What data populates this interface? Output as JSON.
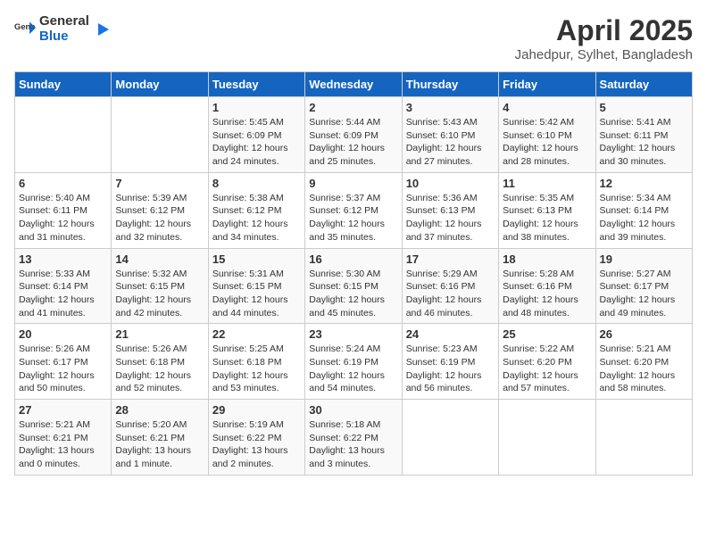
{
  "logo": {
    "general": "General",
    "blue": "Blue"
  },
  "title": "April 2025",
  "subtitle": "Jahedpur, Sylhet, Bangladesh",
  "days_of_week": [
    "Sunday",
    "Monday",
    "Tuesday",
    "Wednesday",
    "Thursday",
    "Friday",
    "Saturday"
  ],
  "weeks": [
    [
      {
        "day": "",
        "info": ""
      },
      {
        "day": "",
        "info": ""
      },
      {
        "day": "1",
        "info": "Sunrise: 5:45 AM\nSunset: 6:09 PM\nDaylight: 12 hours and 24 minutes."
      },
      {
        "day": "2",
        "info": "Sunrise: 5:44 AM\nSunset: 6:09 PM\nDaylight: 12 hours and 25 minutes."
      },
      {
        "day": "3",
        "info": "Sunrise: 5:43 AM\nSunset: 6:10 PM\nDaylight: 12 hours and 27 minutes."
      },
      {
        "day": "4",
        "info": "Sunrise: 5:42 AM\nSunset: 6:10 PM\nDaylight: 12 hours and 28 minutes."
      },
      {
        "day": "5",
        "info": "Sunrise: 5:41 AM\nSunset: 6:11 PM\nDaylight: 12 hours and 30 minutes."
      }
    ],
    [
      {
        "day": "6",
        "info": "Sunrise: 5:40 AM\nSunset: 6:11 PM\nDaylight: 12 hours and 31 minutes."
      },
      {
        "day": "7",
        "info": "Sunrise: 5:39 AM\nSunset: 6:12 PM\nDaylight: 12 hours and 32 minutes."
      },
      {
        "day": "8",
        "info": "Sunrise: 5:38 AM\nSunset: 6:12 PM\nDaylight: 12 hours and 34 minutes."
      },
      {
        "day": "9",
        "info": "Sunrise: 5:37 AM\nSunset: 6:12 PM\nDaylight: 12 hours and 35 minutes."
      },
      {
        "day": "10",
        "info": "Sunrise: 5:36 AM\nSunset: 6:13 PM\nDaylight: 12 hours and 37 minutes."
      },
      {
        "day": "11",
        "info": "Sunrise: 5:35 AM\nSunset: 6:13 PM\nDaylight: 12 hours and 38 minutes."
      },
      {
        "day": "12",
        "info": "Sunrise: 5:34 AM\nSunset: 6:14 PM\nDaylight: 12 hours and 39 minutes."
      }
    ],
    [
      {
        "day": "13",
        "info": "Sunrise: 5:33 AM\nSunset: 6:14 PM\nDaylight: 12 hours and 41 minutes."
      },
      {
        "day": "14",
        "info": "Sunrise: 5:32 AM\nSunset: 6:15 PM\nDaylight: 12 hours and 42 minutes."
      },
      {
        "day": "15",
        "info": "Sunrise: 5:31 AM\nSunset: 6:15 PM\nDaylight: 12 hours and 44 minutes."
      },
      {
        "day": "16",
        "info": "Sunrise: 5:30 AM\nSunset: 6:15 PM\nDaylight: 12 hours and 45 minutes."
      },
      {
        "day": "17",
        "info": "Sunrise: 5:29 AM\nSunset: 6:16 PM\nDaylight: 12 hours and 46 minutes."
      },
      {
        "day": "18",
        "info": "Sunrise: 5:28 AM\nSunset: 6:16 PM\nDaylight: 12 hours and 48 minutes."
      },
      {
        "day": "19",
        "info": "Sunrise: 5:27 AM\nSunset: 6:17 PM\nDaylight: 12 hours and 49 minutes."
      }
    ],
    [
      {
        "day": "20",
        "info": "Sunrise: 5:26 AM\nSunset: 6:17 PM\nDaylight: 12 hours and 50 minutes."
      },
      {
        "day": "21",
        "info": "Sunrise: 5:26 AM\nSunset: 6:18 PM\nDaylight: 12 hours and 52 minutes."
      },
      {
        "day": "22",
        "info": "Sunrise: 5:25 AM\nSunset: 6:18 PM\nDaylight: 12 hours and 53 minutes."
      },
      {
        "day": "23",
        "info": "Sunrise: 5:24 AM\nSunset: 6:19 PM\nDaylight: 12 hours and 54 minutes."
      },
      {
        "day": "24",
        "info": "Sunrise: 5:23 AM\nSunset: 6:19 PM\nDaylight: 12 hours and 56 minutes."
      },
      {
        "day": "25",
        "info": "Sunrise: 5:22 AM\nSunset: 6:20 PM\nDaylight: 12 hours and 57 minutes."
      },
      {
        "day": "26",
        "info": "Sunrise: 5:21 AM\nSunset: 6:20 PM\nDaylight: 12 hours and 58 minutes."
      }
    ],
    [
      {
        "day": "27",
        "info": "Sunrise: 5:21 AM\nSunset: 6:21 PM\nDaylight: 13 hours and 0 minutes."
      },
      {
        "day": "28",
        "info": "Sunrise: 5:20 AM\nSunset: 6:21 PM\nDaylight: 13 hours and 1 minute."
      },
      {
        "day": "29",
        "info": "Sunrise: 5:19 AM\nSunset: 6:22 PM\nDaylight: 13 hours and 2 minutes."
      },
      {
        "day": "30",
        "info": "Sunrise: 5:18 AM\nSunset: 6:22 PM\nDaylight: 13 hours and 3 minutes."
      },
      {
        "day": "",
        "info": ""
      },
      {
        "day": "",
        "info": ""
      },
      {
        "day": "",
        "info": ""
      }
    ]
  ]
}
